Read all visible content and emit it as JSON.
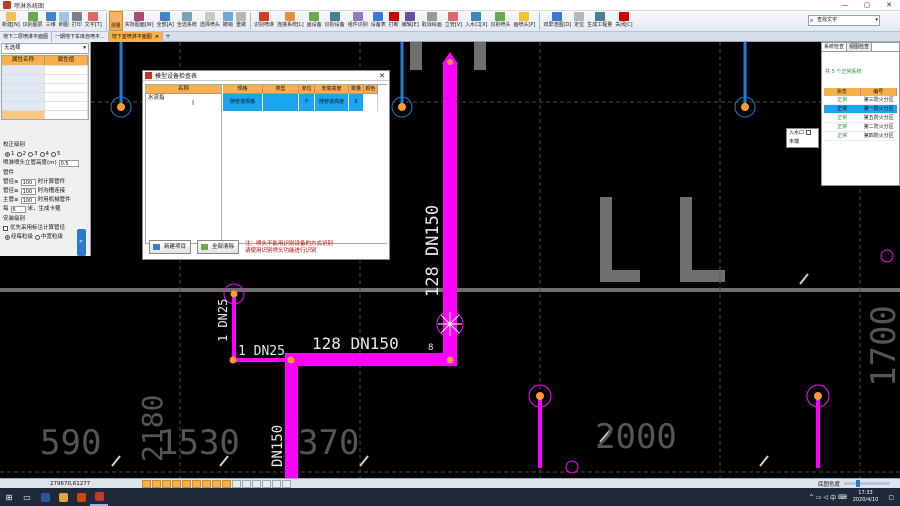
{
  "window": {
    "title": "喷淋系统图",
    "controls": [
      "—",
      "▢",
      "✕"
    ]
  },
  "ribbon": {
    "buttons": [
      {
        "label": "新建[N]",
        "color": "#f2c14e"
      },
      {
        "label": "识别图层",
        "color": "#6aa84f"
      },
      {
        "label": "三维",
        "color": "#3d85c6"
      },
      {
        "label": "刷图",
        "color": "#9fc5e8"
      },
      {
        "label": "打印",
        "color": "#7f7f7f"
      },
      {
        "label": "文字[T]",
        "color": "#e06666"
      },
      {
        "label": "测量",
        "color": "#f6b26b",
        "active": true
      },
      {
        "label": "实际图面[W]",
        "color": "#a64d79"
      },
      {
        "label": "全部[A]",
        "color": "#3d85c6"
      },
      {
        "label": "全选系统",
        "color": "#76a5af"
      },
      {
        "label": "选择喷头",
        "color": "#c9c9c9"
      },
      {
        "label": "撤销",
        "color": "#6fa8dc"
      },
      {
        "label": "重做",
        "color": "#b7b7b7"
      },
      {
        "label": "识别喷淋",
        "color": "#cc4125"
      },
      {
        "label": "连接系统[L]",
        "color": "#e69138"
      },
      {
        "label": "画设备",
        "color": "#6aa84f"
      },
      {
        "label": "识别设备",
        "color": "#45818e"
      },
      {
        "label": "组件识别",
        "color": "#8e7cc3"
      },
      {
        "label": "设备表",
        "color": "#3c78d8"
      },
      {
        "label": "打断",
        "color": "#cc0000"
      },
      {
        "label": "编辑[E]",
        "color": "#674ea7"
      },
      {
        "label": "取消绘画",
        "color": "#999999"
      },
      {
        "label": "立管[V]",
        "color": "#e06666"
      },
      {
        "label": "入水口[X]",
        "color": "#3d85c6"
      },
      {
        "label": "识别喷头",
        "color": "#6aa84f"
      },
      {
        "label": "画喷头[P]",
        "color": "#f1c232"
      },
      {
        "label": "双屏渲图[D]",
        "color": "#3c78d8"
      },
      {
        "label": "定位",
        "color": "#b7b7b7"
      },
      {
        "label": "生成工程量",
        "color": "#45818e"
      },
      {
        "label": "关闭[C]",
        "color": "#cc0000"
      }
    ],
    "search_placeholder": "查找文字"
  },
  "tabs": [
    {
      "label": "地下二层喷淋平面图",
      "active": false
    },
    {
      "label": "一期地下车库自喷平...",
      "active": false
    },
    {
      "label": "地下室喷淋平面图",
      "active": true
    }
  ],
  "left_panel": {
    "selector": "无选择",
    "prop_headers": [
      "属性名称",
      "属性值"
    ],
    "section_calibrate": "校正级别",
    "levels": [
      "1",
      "2",
      "3",
      "4",
      "5"
    ],
    "head_spacing_label": "喷淋喷头立管高度(m)",
    "head_spacing_value": "0.5",
    "section_pipe": "管件",
    "pipe_rows": [
      {
        "prefix": "管径≥",
        "value": "100",
        "suffix": "时计算管件"
      },
      {
        "prefix": "管径≥",
        "value": "100",
        "suffix": "时沟槽连接"
      },
      {
        "prefix": "主管≥",
        "value": "100",
        "suffix": "时用机械管件"
      }
    ],
    "tee_prefix": "每",
    "tee_value": "6",
    "tee_suffix": "米，生成卡箍",
    "section_install": "安装级别",
    "check_label": "优先采用标注计算管径",
    "radio_a": "经每粒级",
    "radio_b": "中宽粒级"
  },
  "dialog": {
    "title": "模型设备检查表",
    "left_header": "名称",
    "left_items": [
      "水流指"
    ],
    "grid_headers": [
      "规格",
      "类型",
      "单位",
      "安装高度",
      "数量",
      "颜色"
    ],
    "grid_rows": [
      [
        "随管道规格",
        "",
        "个",
        "随管道高度",
        "5",
        ""
      ]
    ],
    "btn_new": "新建项目",
    "btn_clear": "全部清除",
    "note_line1": "注：喷头不能用识别设备的方式识别",
    "note_line2": "请使用识别喷头功能进行识别"
  },
  "right_panel": {
    "tabs": [
      "系统检查",
      "视图检查"
    ],
    "summary": "共 5 个正常系统",
    "headers": [
      "状态",
      "编号"
    ],
    "rows": [
      {
        "status": "正常",
        "id": "第三防火分区",
        "selected": false
      },
      {
        "status": "正常",
        "id": "第一防火分区",
        "selected": true
      },
      {
        "status": "正常",
        "id": "第五防火分区",
        "selected": false
      },
      {
        "status": "正常",
        "id": "第二防火分区",
        "selected": false
      },
      {
        "status": "正常",
        "id": "第四防火分区",
        "selected": false
      }
    ]
  },
  "popup_menu": [
    "入水口",
    "末端"
  ],
  "cad": {
    "labels": {
      "dn150_vertical_top": "128 DN150",
      "dn150_horizontal": "128 DN150",
      "dn25_horizontal": "1 DN25",
      "dn25_vertical": "1 DN25",
      "dn150_vertical_bottom": "DN150",
      "dim_590": "590",
      "dim_1530": "1530",
      "dim_370": "370",
      "dim_2180": "2180",
      "dim_2000": "2000",
      "dim_1700": "1700",
      "tag_short": "8"
    },
    "colors": {
      "pipe": "#ff00ff",
      "node": "#ff9933",
      "riser": "#1b7fd6",
      "wall": "#7a7a7a"
    }
  },
  "status": {
    "coords": "279670,61277",
    "bg_label": "底图色度"
  },
  "taskbar": {
    "time": "17:33",
    "date": "2020/4/10",
    "ime": "中",
    "app_colors": [
      "#2b579a",
      "#e8a33d",
      "#d04a02",
      "#c0392b"
    ]
  }
}
